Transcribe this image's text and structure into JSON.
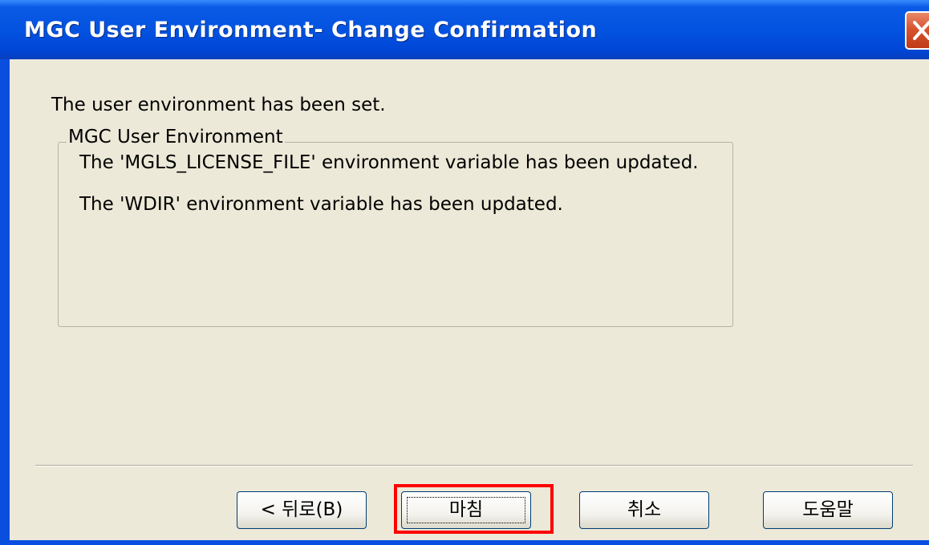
{
  "window": {
    "title": "MGC User Environment- Change Confirmation",
    "close_icon": "close-icon"
  },
  "content": {
    "message": "The user environment has been set.",
    "group": {
      "legend": "MGC User Environment",
      "lines": [
        "The 'MGLS_LICENSE_FILE' environment variable has been updated.",
        "The 'WDIR' environment variable has been updated."
      ]
    }
  },
  "buttons": {
    "back_label": "< 뒤로(B)",
    "finish_label": "마침",
    "cancel_label": "취소",
    "help_label": "도움말",
    "focused": "finish"
  },
  "colors": {
    "titlebar": "#0353e0",
    "close_button": "#d8542f",
    "dialog_bg": "#ece9d8",
    "highlight": "#ff0000"
  }
}
